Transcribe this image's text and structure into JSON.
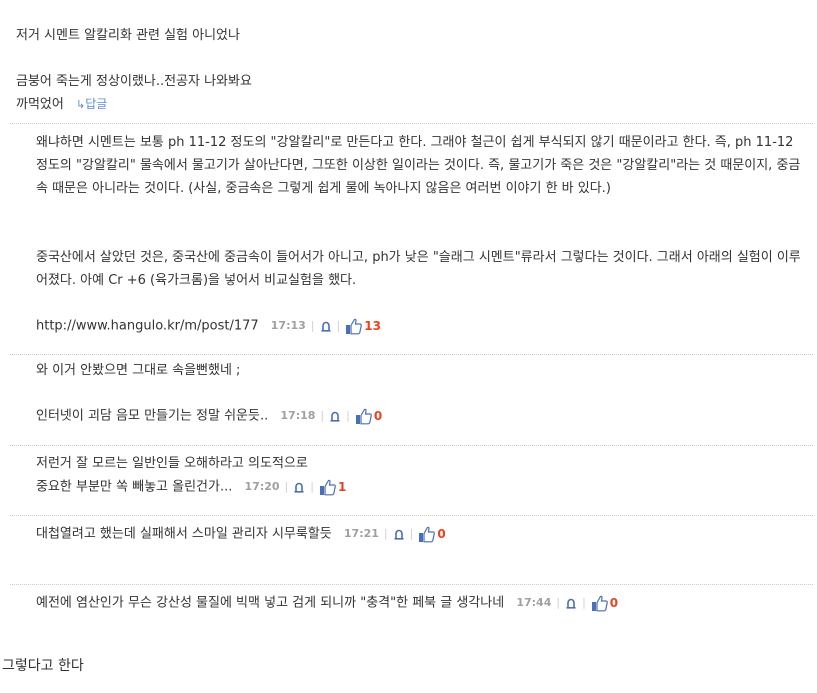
{
  "thread": {
    "title_line": "저거 시멘트 알칼리화 관련 실험 아니었나",
    "top_comment": {
      "line1": "금붕어 죽는게 정상이랬나..전공자 나와봐요",
      "line2": "까먹었어",
      "reply_label": "답글"
    }
  },
  "comments": [
    {
      "p1": "왜냐하면 시멘트는 보통 ph 11-12 정도의 \"강알칼리\"로 만든다고 한다. 그래야 철근이 쉽게 부식되지 않기 때문이라고 한다. 즉, ph 11-12 정도의 \"강알칼리\" 물속에서 물고기가 살아난다면, 그또한 이상한 일이라는 것이다. 즉, 물고기가 죽은 것은 \"강알칼리\"라는 것 때문이지, 중금속 때문은 아니라는 것이다. (사실, 중금속은 그렇게 쉽게 물에 녹아나지 않음은 여러번 이야기 한 바 있다.)",
      "p2": "중국산에서 살았던 것은, 중국산에 중금속이 들어서가 아니고, ph가 낮은 \"슬래그 시멘트\"류라서 그렇다는 것이다. 그래서 아래의 실험이 이루어졌다. 아예 Cr +6 (육가크롬)을 넣어서 비교실험을 했다.",
      "url": "http://www.hangulo.kr/m/post/177",
      "time": "17:13",
      "likes": "13"
    },
    {
      "line1": "와 이거 안봤으면 그대로 속을뻔했네 ;",
      "line2": "인터넷이 괴담 음모 만들기는 정말 쉬운듯..",
      "time": "17:18",
      "likes": "0"
    },
    {
      "line1": "저런거 잘 모르는 일반인들 오해하라고 의도적으로",
      "line2": "중요한 부분만 쏙 빼놓고 올린건가...",
      "time": "17:20",
      "likes": "1"
    },
    {
      "line1": "대첩열려고 했는데 실패해서 스마일 관리자 시무룩할듯",
      "time": "17:21",
      "likes": "0"
    },
    {
      "line1": "예전에 염산인가 무슨 강산성 물질에 빅맥 넣고 검게 되니까 \"충격\"한 페북 글 생각나네",
      "time": "17:44",
      "likes": "0"
    }
  ],
  "footer_text": "그렇다고 한다",
  "colors": {
    "reply_link": "#5a8fd0",
    "like_count": "#e8431f",
    "timestamp": "#a0a0a0",
    "thumb_icon": "#4a6fb5"
  },
  "icons": {
    "reply": "reply-arrow-icon",
    "report": "bell-icon",
    "like": "thumbs-up-icon"
  }
}
